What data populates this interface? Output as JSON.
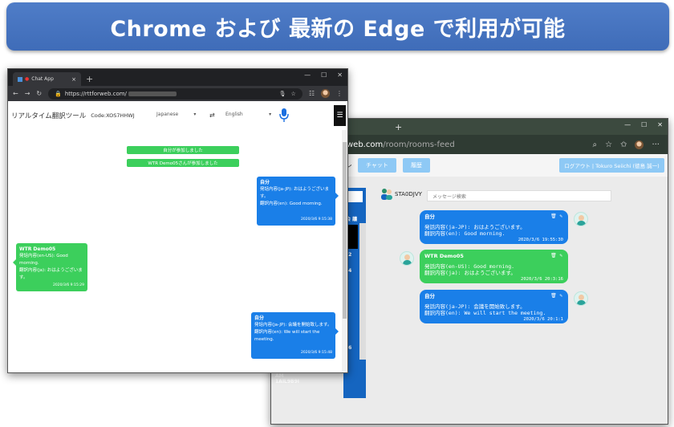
{
  "banner": {
    "title": "Chrome および 最新の Edge で利用が可能"
  },
  "win1": {
    "tab_title": "Chat App",
    "tab_close": "×",
    "new_tab": "+",
    "url": "https://rttforweb.com/",
    "app_title": "リアルタイム翻訳ツール",
    "room_code": "Code:XOS7HHWJ",
    "source_lang": "Japanese",
    "swap_icon": "⇄",
    "target_lang": "English",
    "menu_icon": "☰",
    "system_messages": [
      "自分が参加しました",
      "WTR Demo05さんが参加しました"
    ],
    "messages": [
      {
        "name": "自分",
        "line1": "発話内容(ja-JP): おはようございます。",
        "line2": "翻訳内容(en): Good morning.",
        "time": "2020/3/6 9:15:38"
      },
      {
        "name": "WTR Demo05",
        "line1": "発話内容(en-US): Good morning.",
        "line2": "翻訳内容(ja): おはようございます。",
        "time": "2020/3/6 9:15:29"
      },
      {
        "name": "自分",
        "line1": "発話内容(ja-JP): 会議を開始致します。",
        "line2": "翻訳内容(en): We will start the meeting.",
        "time": "2020/3/6 9:15:48"
      }
    ]
  },
  "win2": {
    "new_tab": "+",
    "url_host": "https://rttforweb.com",
    "url_path": "/room/rooms-feed",
    "nav_fragment": "レ",
    "chat_button": "チャット",
    "history_button": "履歴",
    "logout_button": "ログアウト | Tokuro Seiichi (徳島 誠一)",
    "user_code": "STA0DJVY",
    "search_placeholder": "メッセージ検索",
    "sidebar_labels": [
      "会 議",
      "02",
      "14",
      "16"
    ],
    "room_entry": {
      "line1": "会議_2/28/2020, 9:07:18",
      "line2": "AM",
      "line3": "1AIL9B9I"
    },
    "messages": [
      {
        "name": "自分",
        "line1": "発話内容(ja-JP): おはようございます。",
        "line2": "翻訳内容(en): Good morning.",
        "time": "2020/3/6 19:55:30"
      },
      {
        "name": "WTR Demo05",
        "line1": "発話内容(en-US): Good morning.",
        "line2": "翻訳内容(ja): おはようございます。",
        "time": "2020/3/6 20:3:16"
      },
      {
        "name": "自分",
        "line1": "発話内容(ja-JP): 会議を開始致します。",
        "line2": "翻訳内容(en): We will start the meeting.",
        "time": "2020/3/6 20:1:1"
      }
    ]
  }
}
